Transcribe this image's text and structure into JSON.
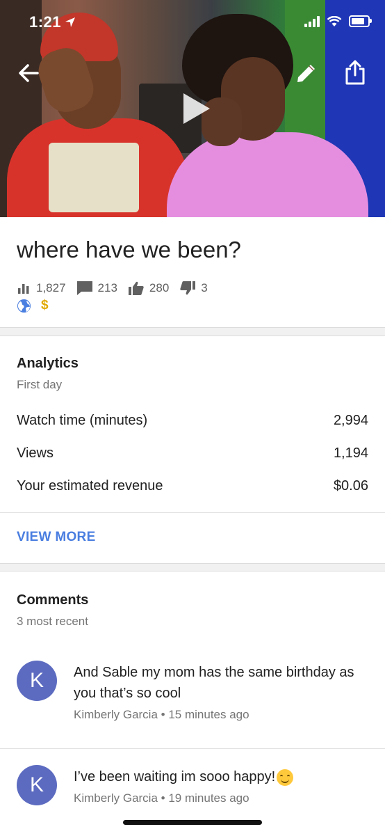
{
  "status_bar": {
    "time": "1:21"
  },
  "video": {
    "title": "where have we been?",
    "stats": {
      "views": "1,827",
      "comments": "213",
      "likes": "280",
      "dislikes": "3"
    },
    "badge_currency": "$"
  },
  "analytics": {
    "title": "Analytics",
    "subtitle": "First day",
    "rows": [
      {
        "label": "Watch time (minutes)",
        "value": "2,994"
      },
      {
        "label": "Views",
        "value": "1,194"
      },
      {
        "label": "Your estimated revenue",
        "value": "$0.06"
      }
    ],
    "view_more": "VIEW MORE"
  },
  "comments": {
    "title": "Comments",
    "subtitle": "3 most recent",
    "items": [
      {
        "initial": "K",
        "text": "And Sable my mom has the same birthday as you that’s so cool",
        "author": "Kimberly Garcia",
        "time": "15 minutes ago"
      },
      {
        "initial": "K",
        "text": "I’ve been waiting im sooo happy!",
        "author": "Kimberly Garcia",
        "time": "19 minutes ago"
      }
    ]
  },
  "colors": {
    "accent": "#4a7ee0",
    "avatar": "#5c6bc0",
    "monetization": "#e0a800"
  },
  "icons": [
    "back-arrow-icon",
    "pencil-icon",
    "share-icon",
    "play-icon",
    "bar-chart-icon",
    "comment-icon",
    "thumbs-up-icon",
    "thumbs-down-icon",
    "globe-icon",
    "dollar-icon",
    "smiling-emoji-icon"
  ]
}
